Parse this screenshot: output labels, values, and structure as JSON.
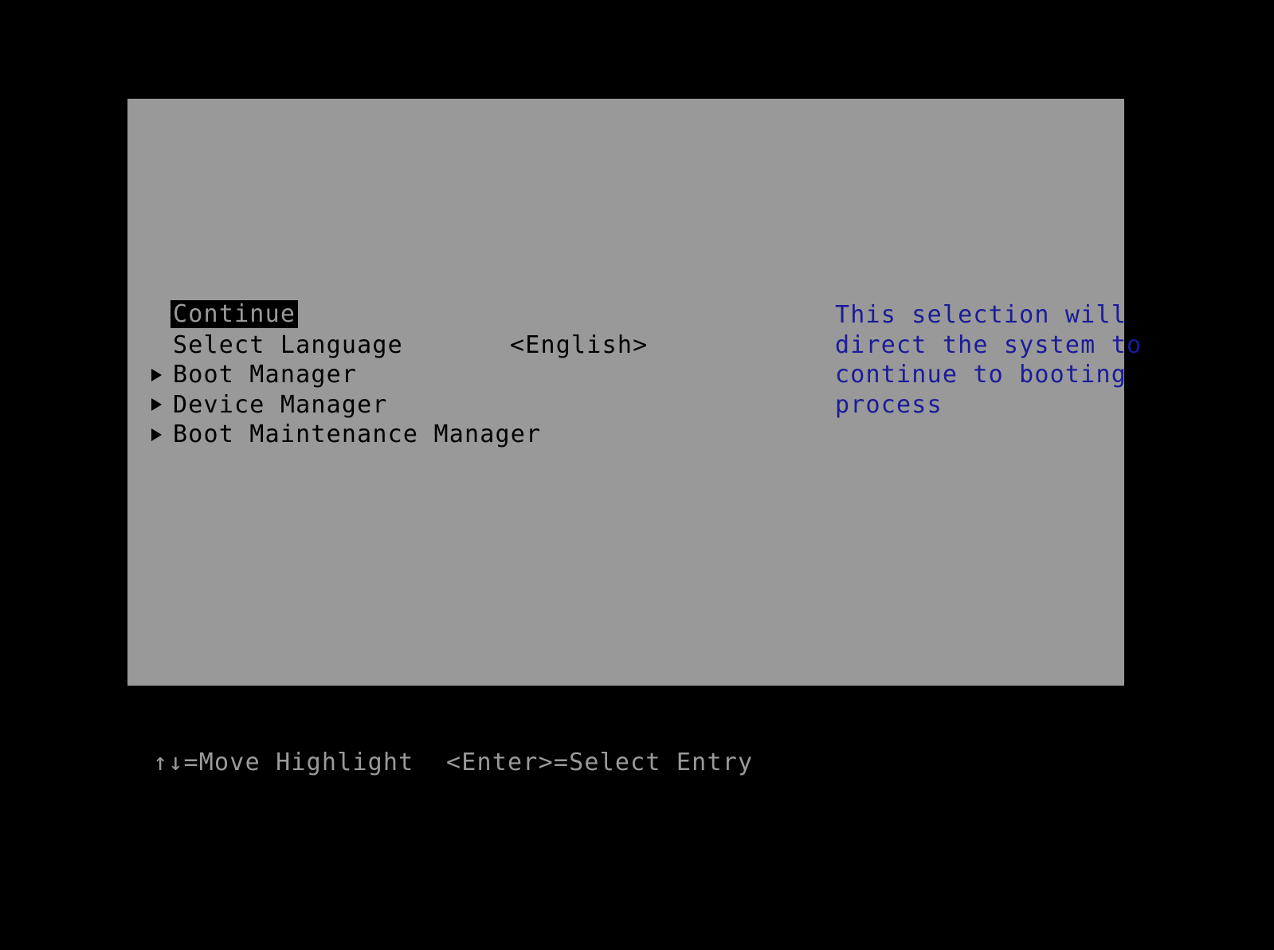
{
  "screen": {
    "background_color": "#000000",
    "panel_color": "#999999",
    "text_color": "#000000",
    "help_text_color": "#1b1b99",
    "hotkey_text_color": "#9a9a9a",
    "highlight_background": "#000000",
    "highlight_text_color": "#9a9a9a"
  },
  "menu": {
    "items": [
      {
        "label": "Continue",
        "value": "",
        "marker": "none",
        "selected": true
      },
      {
        "label": "Select Language",
        "value": "<English>",
        "marker": "none",
        "selected": false
      },
      {
        "label": "Boot Manager",
        "value": "",
        "marker": "submenu-triangle-icon",
        "selected": false
      },
      {
        "label": "Device Manager",
        "value": "",
        "marker": "submenu-triangle-icon",
        "selected": false
      },
      {
        "label": "Boot Maintenance Manager",
        "value": "",
        "marker": "submenu-triangle-icon",
        "selected": false
      }
    ]
  },
  "help": {
    "lines": [
      "This selection will",
      "direct the system to",
      "continue to booting",
      "process"
    ]
  },
  "hotkeys": {
    "move_highlight": "↑↓=Move Highlight",
    "select_entry": "<Enter>=Select Entry"
  }
}
